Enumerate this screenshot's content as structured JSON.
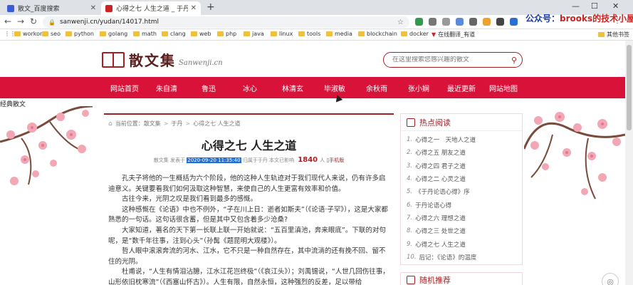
{
  "browser": {
    "tabs": [
      {
        "title": "散文_百度搜索",
        "favicon": "baidu-paw-icon"
      },
      {
        "title": "心得之七 人生之道 _ 于丹",
        "favicon": "sanwenji-icon"
      }
    ],
    "url": "sanwenji.cn/yudan/14017.html",
    "bookmarks": [
      "workon",
      "seo",
      "python",
      "golang",
      "math",
      "clang",
      "web",
      "php",
      "java",
      "linux",
      "tools",
      "media",
      "blockchain",
      "docker",
      "在线翻译_有道",
      "其他书签"
    ]
  },
  "overlay": {
    "prefix": "公众号：",
    "brand": "brooks的技术小屋"
  },
  "site": {
    "logo_cn": "散文集",
    "logo_en": "Sanwenji.cn",
    "search_placeholder": "在这里搜索您感兴趣的散文"
  },
  "nav": [
    "网站首页",
    "朱自清",
    "鲁迅",
    "冰心",
    "林清玄",
    "毕淑敏",
    "余秋雨",
    "张小娴",
    "最近更新",
    "网站地图"
  ],
  "side_label": "经典散文",
  "breadcrumb": {
    "current_label": "当前位置：",
    "items": [
      "散文集",
      "于丹",
      "心得之七 人生之道"
    ]
  },
  "article": {
    "title": "心得之七 人生之道",
    "meta_prefix": "散文集 发表于",
    "date": "2020-09-20 11:35:40",
    "meta_middle": "归属于于丹 本文已影响",
    "views": "1840",
    "views_suffix": "人",
    "mobile": "手机版",
    "paragraphs": [
      "孔夫子将他的一生概括为六个阶段，他的这种人生轨迹对于我们现代人来说，仍有许多启迪意义。关键要看我们如何汲取这种智慧，来使自己的人生更富有效率和价值。",
      "古往今来，光阴之叹是我们看到最多的感慨。",
      "这种感慨在《论语》中也不例外，“子在川上日：逝者如斯夫”（《论语·子罕》），这是大家都熟悉的一句话。这句话很含蓄，但是其中又包含着多少沧桑?",
      "大家知道，著名的天下第一长联上联一开始就说：“五百里滇池，奔来眼底”。下联的对句呢，是“数千年往事，注到心头”（孙髯《题昆明大观楼》）。",
      "哲人眼中滚滚奔流的河水、江水，它不只是一种自然存在，其中流淌的还有挽不回、留不住的光阴。",
      "杜甫说，“人生有情泪沾臆，江水江花岂终极”（《哀江头》）；刘禹锡说，“人世几回伤往事，山形依旧枕寒流”（《西塞山怀古》）。人生有限，自然永恒，这种强烈的反差，足以带给"
    ]
  },
  "hot": {
    "title": "热点阅读",
    "items": [
      "心得之一　天地人之道",
      "心得之五 朋友之道",
      "心得之四 君子之道",
      "心得之二 心灵之道",
      "《于丹论语心得》序",
      "于丹论语心得",
      "心得之六 理想之道",
      "心得之三 处世之道",
      "心得之七 人生之道",
      "后记：《论语》的温度"
    ]
  },
  "rec": {
    "title": "随机推荐"
  }
}
